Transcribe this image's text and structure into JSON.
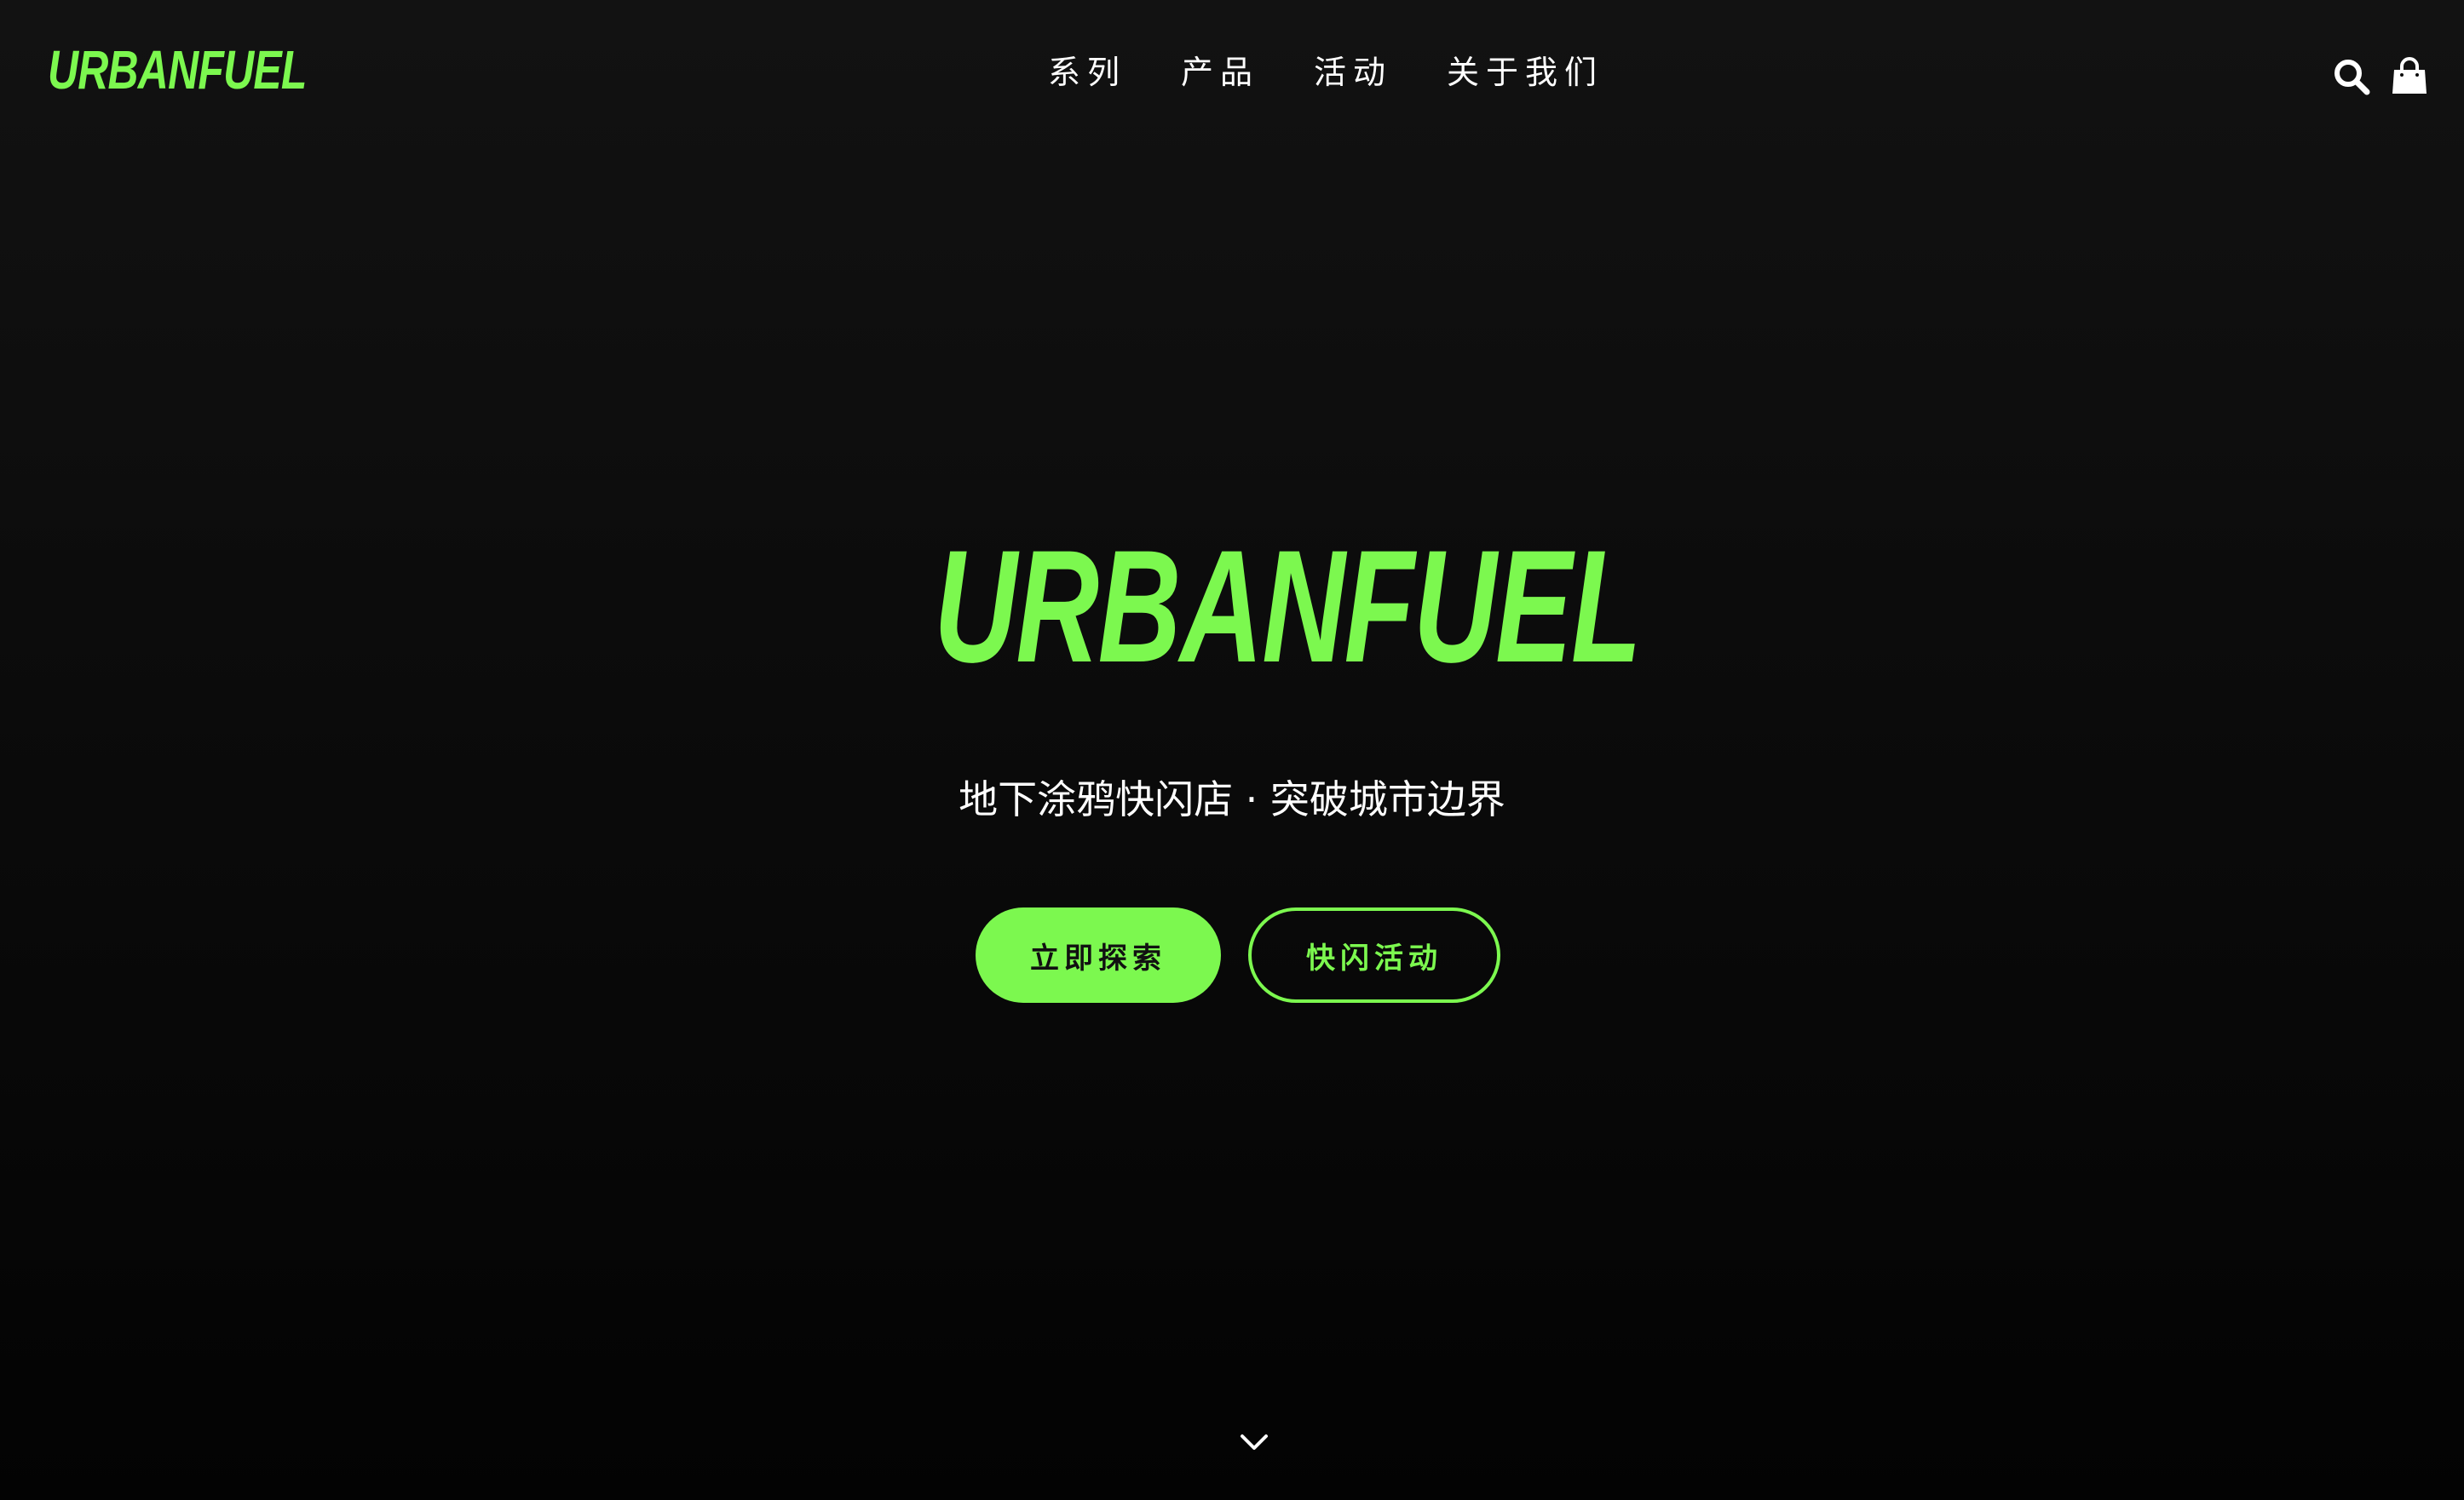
{
  "header": {
    "logo": "URBANFUEL",
    "nav": [
      "系列",
      "产品",
      "活动",
      "关于我们"
    ],
    "icons": {
      "search": "search-icon",
      "cart": "shopping-bag-icon"
    }
  },
  "hero": {
    "title": "URBANFUEL",
    "subtitle": "地下涂鸦快闪店 · 突破城市边界",
    "primary_button": "立即探索",
    "secondary_button": "快闪活动",
    "scroll_icon": "chevron-down-icon"
  },
  "colors": {
    "accent": "#7cf84f",
    "background": "#0a0a0a",
    "text": "#ffffff"
  }
}
